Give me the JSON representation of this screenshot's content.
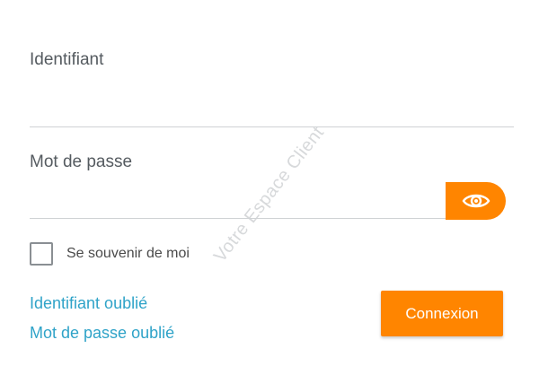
{
  "form": {
    "username_label": "Identifiant",
    "username_value": "",
    "password_label": "Mot de passe",
    "password_value": "",
    "remember_label": "Se souvenir de moi",
    "remember_checked": false,
    "forgot_username": "Identifiant oublié",
    "forgot_password": "Mot de passe oublié",
    "submit_label": "Connexion",
    "toggle_icon": "eye-icon"
  },
  "watermark": "Votre Espace Client",
  "colors": {
    "accent": "#ff8500",
    "link": "#2fa3c8",
    "label": "#555b60"
  }
}
